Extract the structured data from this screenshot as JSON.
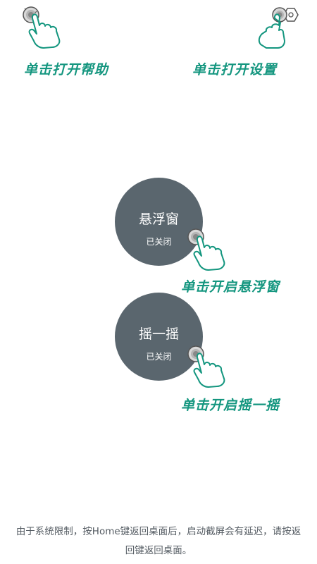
{
  "top_left": {
    "label": "单击打开帮助",
    "icon": "help-icon"
  },
  "top_right": {
    "label": "单击打开设置",
    "icon": "settings-icon"
  },
  "floating_window": {
    "title": "悬浮窗",
    "status": "已关闭",
    "hint": "单击开启悬浮窗"
  },
  "shake": {
    "title": "摇一摇",
    "status": "已关闭",
    "hint": "单击开启摇一摇"
  },
  "notice": "由于系统限制，按Home键返回桌面后，启动截屏会有延迟，请按返回键返回桌面。",
  "colors": {
    "accent": "#14967f",
    "circle": "#5a666e"
  }
}
